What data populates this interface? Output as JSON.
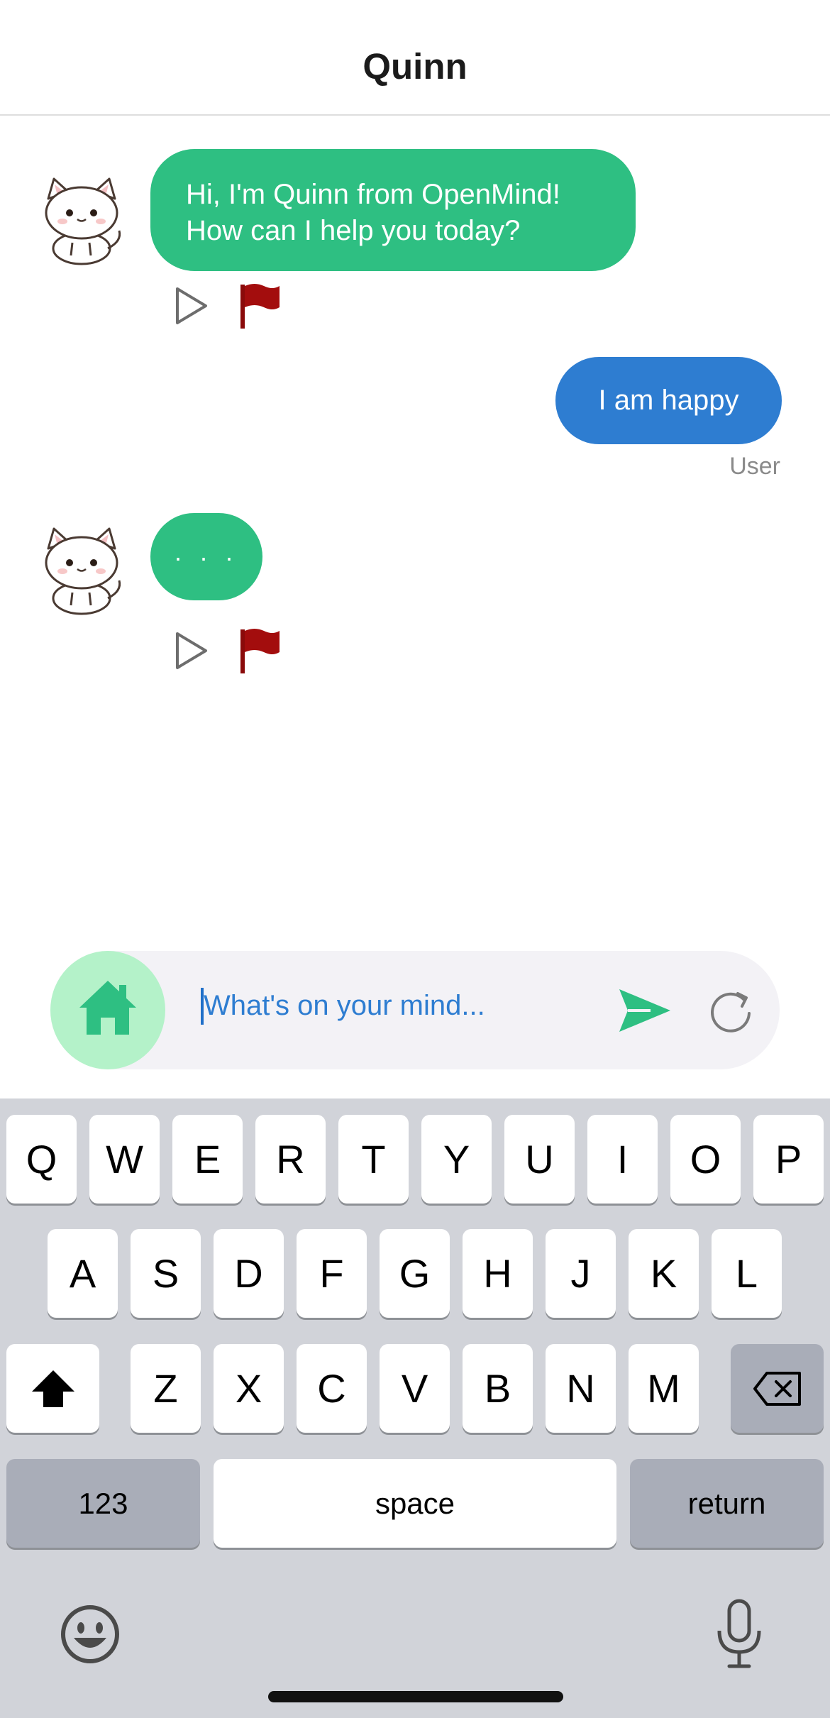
{
  "header": {
    "title": "Quinn"
  },
  "messages": [
    {
      "sender": "bot",
      "lines": [
        "Hi, I'm Quinn from OpenMind!",
        "How can I help you today?"
      ],
      "actions": [
        "play-icon",
        "flag-icon"
      ]
    },
    {
      "sender": "user",
      "text": "I am happy",
      "label": "User"
    },
    {
      "sender": "bot",
      "text": ". . .",
      "actions": [
        "play-icon",
        "flag-icon"
      ]
    }
  ],
  "composer": {
    "placeholder": "What's on your mind...",
    "home_icon": "home-icon",
    "send_icon": "send-icon",
    "refresh_icon": "refresh-icon"
  },
  "keyboard": {
    "row1": [
      "Q",
      "W",
      "E",
      "R",
      "T",
      "Y",
      "U",
      "I",
      "O",
      "P"
    ],
    "row2": [
      "A",
      "S",
      "D",
      "F",
      "G",
      "H",
      "J",
      "K",
      "L"
    ],
    "row3": [
      "Z",
      "X",
      "C",
      "V",
      "B",
      "N",
      "M"
    ],
    "shift_icon": "shift-icon",
    "delete_icon": "backspace-icon",
    "numbers_label": "123",
    "space_label": "space",
    "return_label": "return",
    "emoji_icon": "emoji-icon",
    "mic_icon": "microphone-icon"
  },
  "colors": {
    "bot_bubble": "#2ebf82",
    "user_bubble": "#2e7dd1",
    "flag": "#a30d0d",
    "home_button": "#b4f2c9",
    "keyboard_bg": "#d1d3d9"
  }
}
